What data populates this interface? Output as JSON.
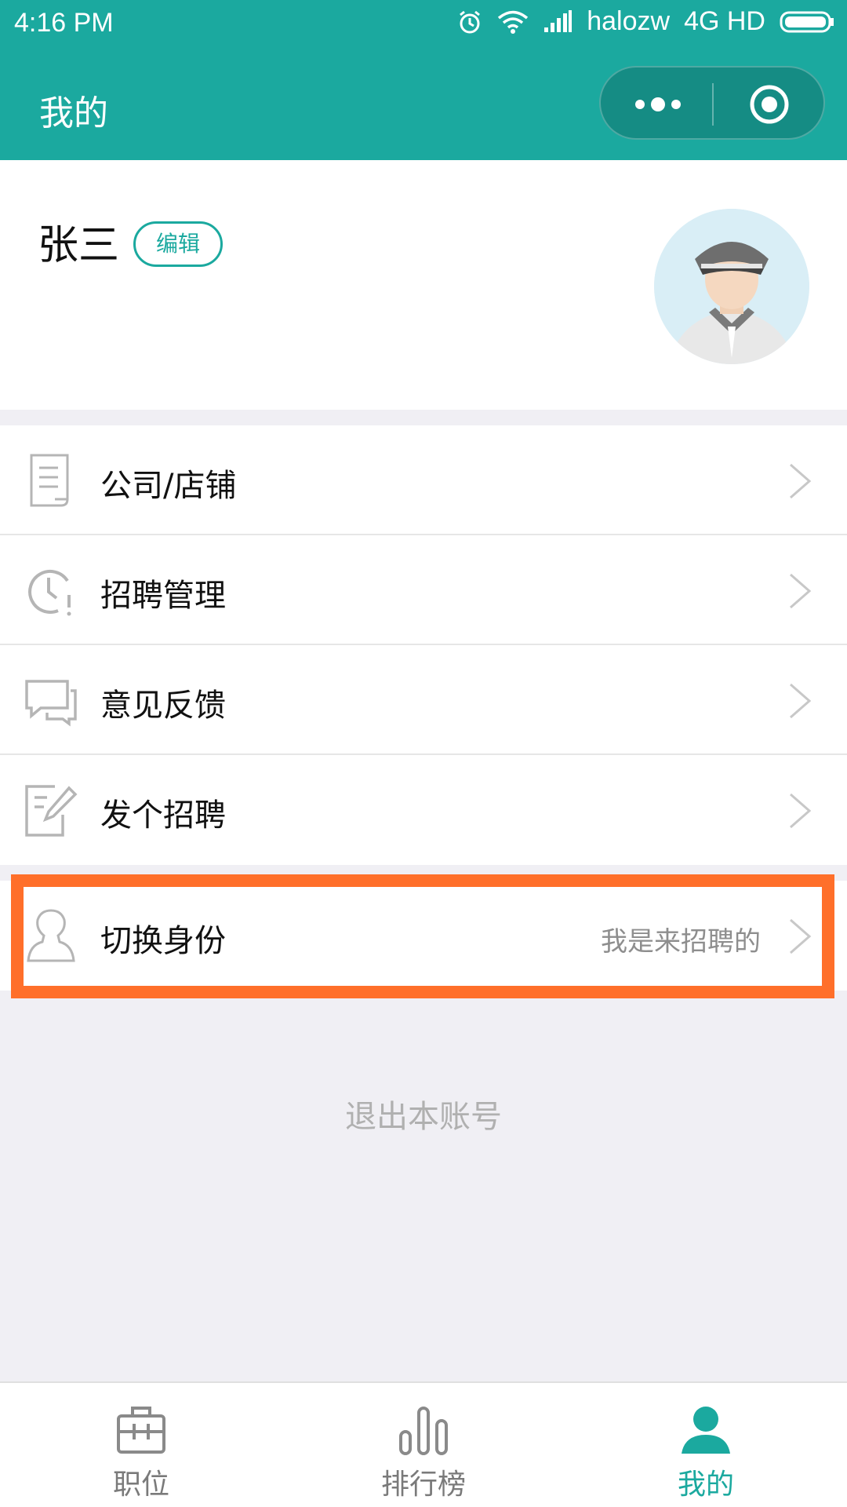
{
  "status_bar": {
    "time": "4:16 PM",
    "carrier": "halozw",
    "network": "4G HD"
  },
  "header": {
    "title": "我的",
    "more_icon": "more-dots-icon",
    "close_icon": "target-circle-icon"
  },
  "profile": {
    "name": "张三",
    "edit_label": "编辑"
  },
  "menu": {
    "items": [
      {
        "label": "公司/店铺",
        "icon": "document-icon"
      },
      {
        "label": "招聘管理",
        "icon": "clock-alert-icon"
      },
      {
        "label": "意见反馈",
        "icon": "chat-bubble-icon"
      },
      {
        "label": "发个招聘",
        "icon": "edit-note-icon"
      }
    ]
  },
  "switch_identity": {
    "label": "切换身份",
    "value": "我是来招聘的",
    "icon": "person-outline-icon"
  },
  "logout_label": "退出本账号",
  "tabbar": {
    "items": [
      {
        "label": "职位",
        "icon": "briefcase-icon",
        "active": false
      },
      {
        "label": "排行榜",
        "icon": "bar-chart-icon",
        "active": false
      },
      {
        "label": "我的",
        "icon": "person-icon",
        "active": true
      }
    ]
  },
  "colors": {
    "accent": "#1ba99f",
    "highlight": "#ff6f2a"
  }
}
